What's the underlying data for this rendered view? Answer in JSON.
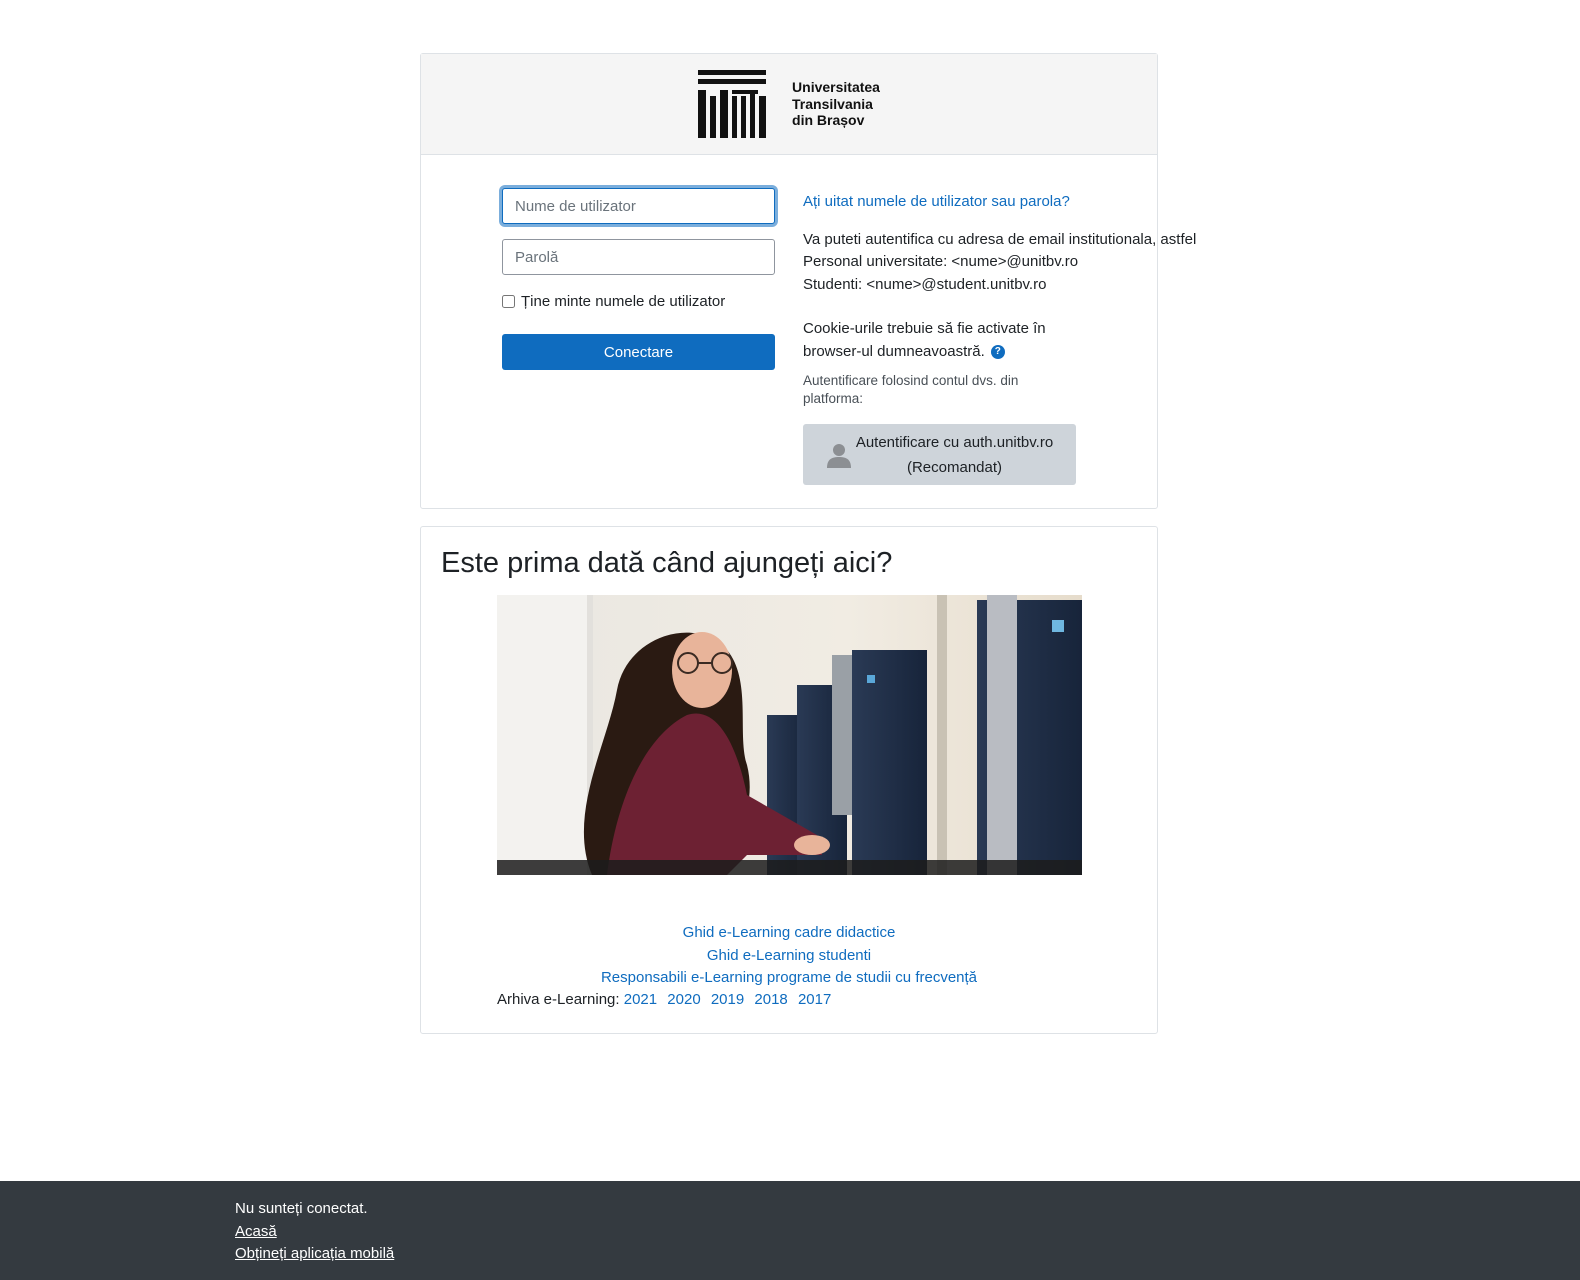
{
  "header": {
    "logo_lines": [
      "Universitatea",
      "Transilvania",
      "din Brașov"
    ]
  },
  "login": {
    "username_placeholder": "Nume de utilizator",
    "password_placeholder": "Parolă",
    "remember_label": "Ține minte numele de utilizator",
    "remember_checked": false,
    "submit_label": "Conectare"
  },
  "side": {
    "forgot_link": "Ați uitat numele de utilizator sau parola?",
    "instructions": [
      "Va puteti autentifica cu adresa de email institutionala, astfel",
      "Personal universitate: <nume>@unitbv.ro",
      "Studenti: <nume>@student.unitbv.ro"
    ],
    "cookies_lines": [
      "Cookie-urile trebuie să fie activate în",
      "browser-ul dumneavoastră."
    ],
    "help_icon": "question-circle-icon",
    "sso_intro": "Autentificare folosind contul dvs. din platforma:",
    "sso_button_line1": "Autentificare cu auth.unitbv.ro",
    "sso_button_line2": "(Recomandat)",
    "sso_icon": "user-silhouette-icon"
  },
  "info": {
    "title": "Este prima dată când ajungeți aici?",
    "links": [
      "Ghid e-Learning cadre didactice",
      "Ghid e-Learning studenti",
      "Responsabili e-Learning programe de studii cu frecvență"
    ],
    "archive_label": "Arhiva e-Learning:",
    "archive_years": [
      "2021",
      "2020",
      "2019",
      "2018",
      "2017"
    ]
  },
  "footer": {
    "status": "Nu sunteți conectat.",
    "home_link": "Acasă",
    "mobile_link": "Obțineți aplicația mobilă"
  },
  "colors": {
    "link": "#0f6cbf",
    "primary_button": "#0f6cbf",
    "footer_bg": "#343a40",
    "sso_button_bg": "#ced4da"
  }
}
